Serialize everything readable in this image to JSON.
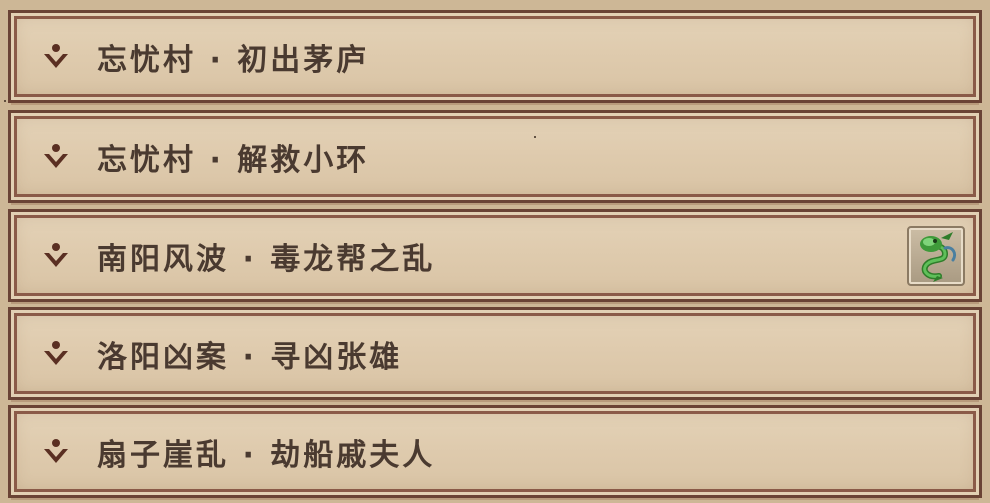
{
  "quests": [
    {
      "title": "忘忧村 · 初出茅庐",
      "has_reward": false
    },
    {
      "title": "忘忧村 · 解救小环",
      "has_reward": false
    },
    {
      "title": "南阳风波 · 毒龙帮之乱",
      "has_reward": true,
      "reward_icon": "jade-dragon-icon"
    },
    {
      "title": "洛阳凶案 · 寻凶张雄",
      "has_reward": false
    },
    {
      "title": "扇子崖乱 · 劫船戚夫人",
      "has_reward": false
    }
  ],
  "colors": {
    "text": "#4a3a30",
    "chevron": "#5a2f22",
    "border": "#6a4335",
    "dragon": "#3f9a3a"
  }
}
